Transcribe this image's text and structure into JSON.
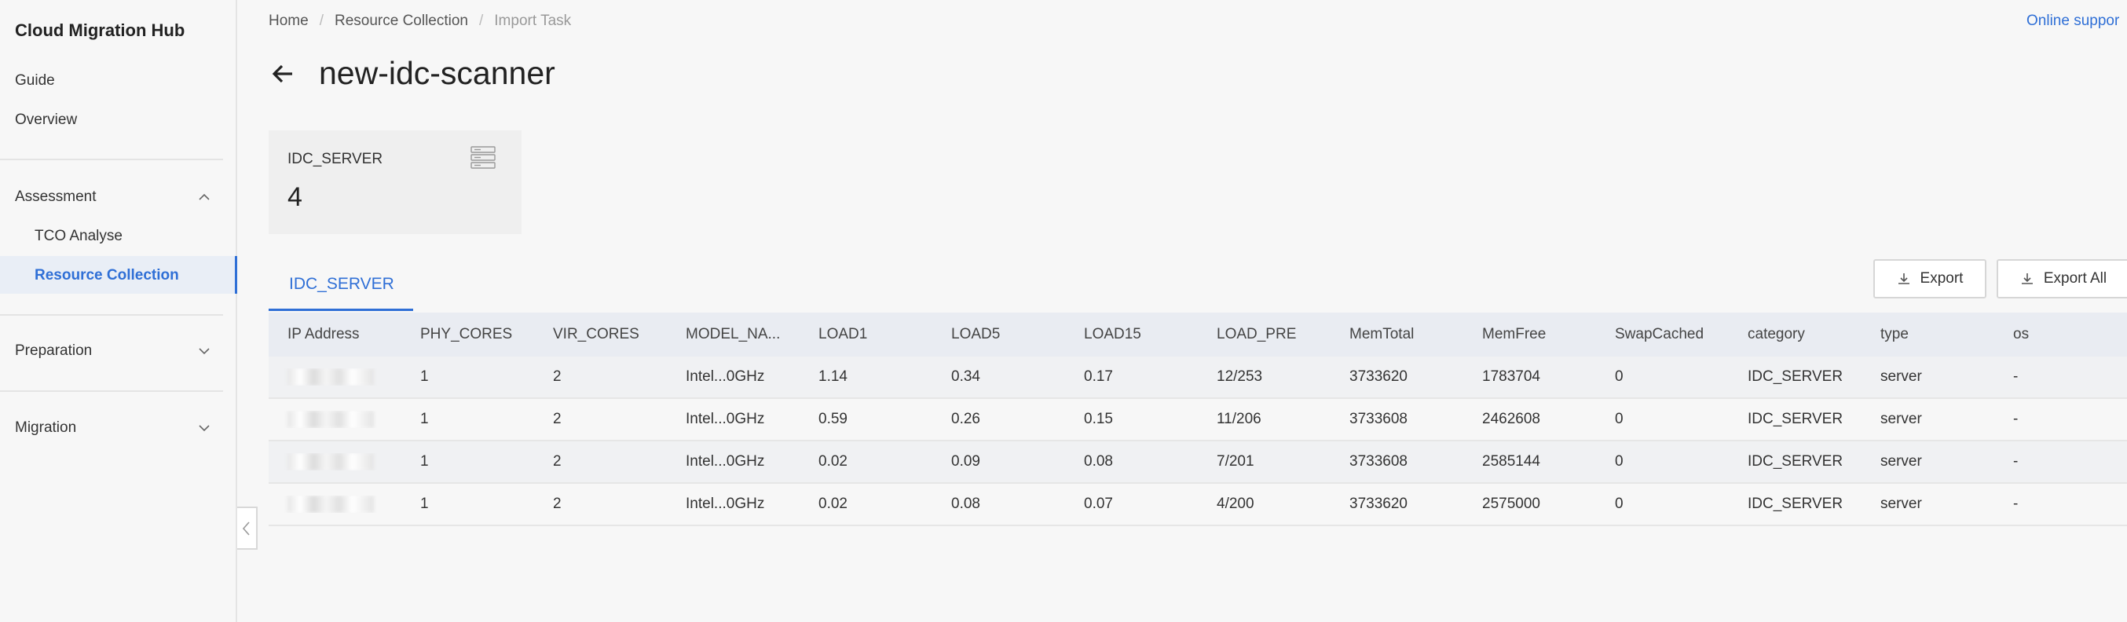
{
  "sidebar": {
    "brand": "Cloud Migration Hub",
    "items": [
      {
        "label": "Guide"
      },
      {
        "label": "Overview"
      }
    ],
    "assessment": {
      "label": "Assessment",
      "children": [
        {
          "label": "TCO Analyse"
        },
        {
          "label": "Resource Collection"
        }
      ]
    },
    "preparation": {
      "label": "Preparation"
    },
    "migration": {
      "label": "Migration"
    }
  },
  "breadcrumb": {
    "items": [
      "Home",
      "Resource Collection",
      "Import Task"
    ],
    "separator": "/"
  },
  "header": {
    "support_link": "Online suppor",
    "title": "new-idc-scanner"
  },
  "stat_card": {
    "label": "IDC_SERVER",
    "value": "4",
    "icon": "server-icon"
  },
  "tabs": [
    {
      "label": "IDC_SERVER",
      "active": true
    }
  ],
  "toolbar": {
    "export_label": "Export",
    "export_all_label": "Export All"
  },
  "table": {
    "columns": [
      "IP Address",
      "PHY_CORES",
      "VIR_CORES",
      "MODEL_NA...",
      "LOAD1",
      "LOAD5",
      "LOAD15",
      "LOAD_PRE",
      "MemTotal",
      "MemFree",
      "SwapCached",
      "category",
      "type",
      "os"
    ],
    "rows": [
      [
        "",
        "1",
        "2",
        "Intel...0GHz",
        "1.14",
        "0.34",
        "0.17",
        "12/253",
        "3733620",
        "1783704",
        "0",
        "IDC_SERVER",
        "server",
        "-"
      ],
      [
        "",
        "1",
        "2",
        "Intel...0GHz",
        "0.59",
        "0.26",
        "0.15",
        "11/206",
        "3733608",
        "2462608",
        "0",
        "IDC_SERVER",
        "server",
        "-"
      ],
      [
        "",
        "1",
        "2",
        "Intel...0GHz",
        "0.02",
        "0.09",
        "0.08",
        "7/201",
        "3733608",
        "2585144",
        "0",
        "IDC_SERVER",
        "server",
        "-"
      ],
      [
        "",
        "1",
        "2",
        "Intel...0GHz",
        "0.02",
        "0.08",
        "0.07",
        "4/200",
        "3733620",
        "2575000",
        "0",
        "IDC_SERVER",
        "server",
        "-"
      ]
    ]
  },
  "colors": {
    "accent": "#2f6fd6",
    "header_bg": "#e9ecf2",
    "page_bg": "#f7f7f7"
  }
}
